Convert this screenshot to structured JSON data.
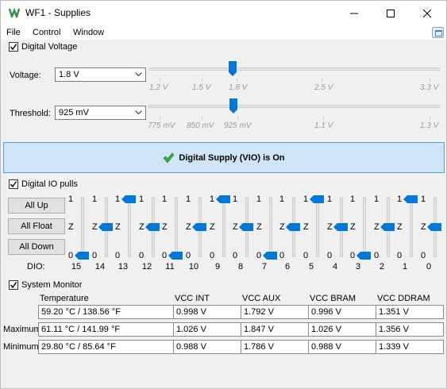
{
  "window": {
    "title": "WF1 - Supplies"
  },
  "menu": [
    "File",
    "Control",
    "Window"
  ],
  "digital_voltage": {
    "checkbox_label": "Digital Voltage",
    "checked": true,
    "voltage_label": "Voltage:",
    "voltage_value": "1.8 V",
    "voltage_ticks": [
      "1.2 V",
      "1.5 V",
      "1.8 V",
      "2.5 V",
      "3.3 V"
    ],
    "threshold_label": "Threshold:",
    "threshold_value": "925 mV",
    "threshold_ticks": [
      "775 mV",
      "850 mV",
      "925 mV",
      "1.1 V",
      "1.3 V"
    ]
  },
  "supply_button": {
    "label": "Digital Supply (VIO) is On",
    "accent": "#cfe5f7"
  },
  "dio": {
    "checkbox_label": "Digital IO pulls",
    "checked": true,
    "buttons": [
      "All Up",
      "All Float",
      "All Down"
    ],
    "prefix_label": "DIO:",
    "level_labels": {
      "high": "1",
      "float": "Z",
      "low": "0"
    },
    "channels": [
      {
        "num": "15",
        "state": "0"
      },
      {
        "num": "14",
        "state": "Z"
      },
      {
        "num": "13",
        "state": "1"
      },
      {
        "num": "12",
        "state": "Z"
      },
      {
        "num": "11",
        "state": "0"
      },
      {
        "num": "10",
        "state": "Z"
      },
      {
        "num": "9",
        "state": "1"
      },
      {
        "num": "8",
        "state": "Z"
      },
      {
        "num": "7",
        "state": "0"
      },
      {
        "num": "6",
        "state": "Z"
      },
      {
        "num": "5",
        "state": "1"
      },
      {
        "num": "4",
        "state": "Z"
      },
      {
        "num": "3",
        "state": "0"
      },
      {
        "num": "2",
        "state": "Z"
      },
      {
        "num": "1",
        "state": "1"
      },
      {
        "num": "0",
        "state": "Z"
      }
    ]
  },
  "system_monitor": {
    "checkbox_label": "System Monitor",
    "checked": true,
    "columns": [
      "Temperature",
      "VCC INT",
      "VCC AUX",
      "VCC BRAM",
      "VCC DDRAM"
    ],
    "rows": [
      {
        "label": "",
        "values": [
          "59.20 °C / 138.56 °F",
          "0.998 V",
          "1.792 V",
          "0.996 V",
          "1.351 V"
        ]
      },
      {
        "label": "Maximum",
        "values": [
          "61.11 °C / 141.99 °F",
          "1.026 V",
          "1.847 V",
          "1.026 V",
          "1.356 V"
        ]
      },
      {
        "label": "Minimum",
        "values": [
          "29.80 °C / 85.64 °F",
          "0.988 V",
          "1.786 V",
          "0.988 V",
          "1.339 V"
        ]
      }
    ]
  }
}
